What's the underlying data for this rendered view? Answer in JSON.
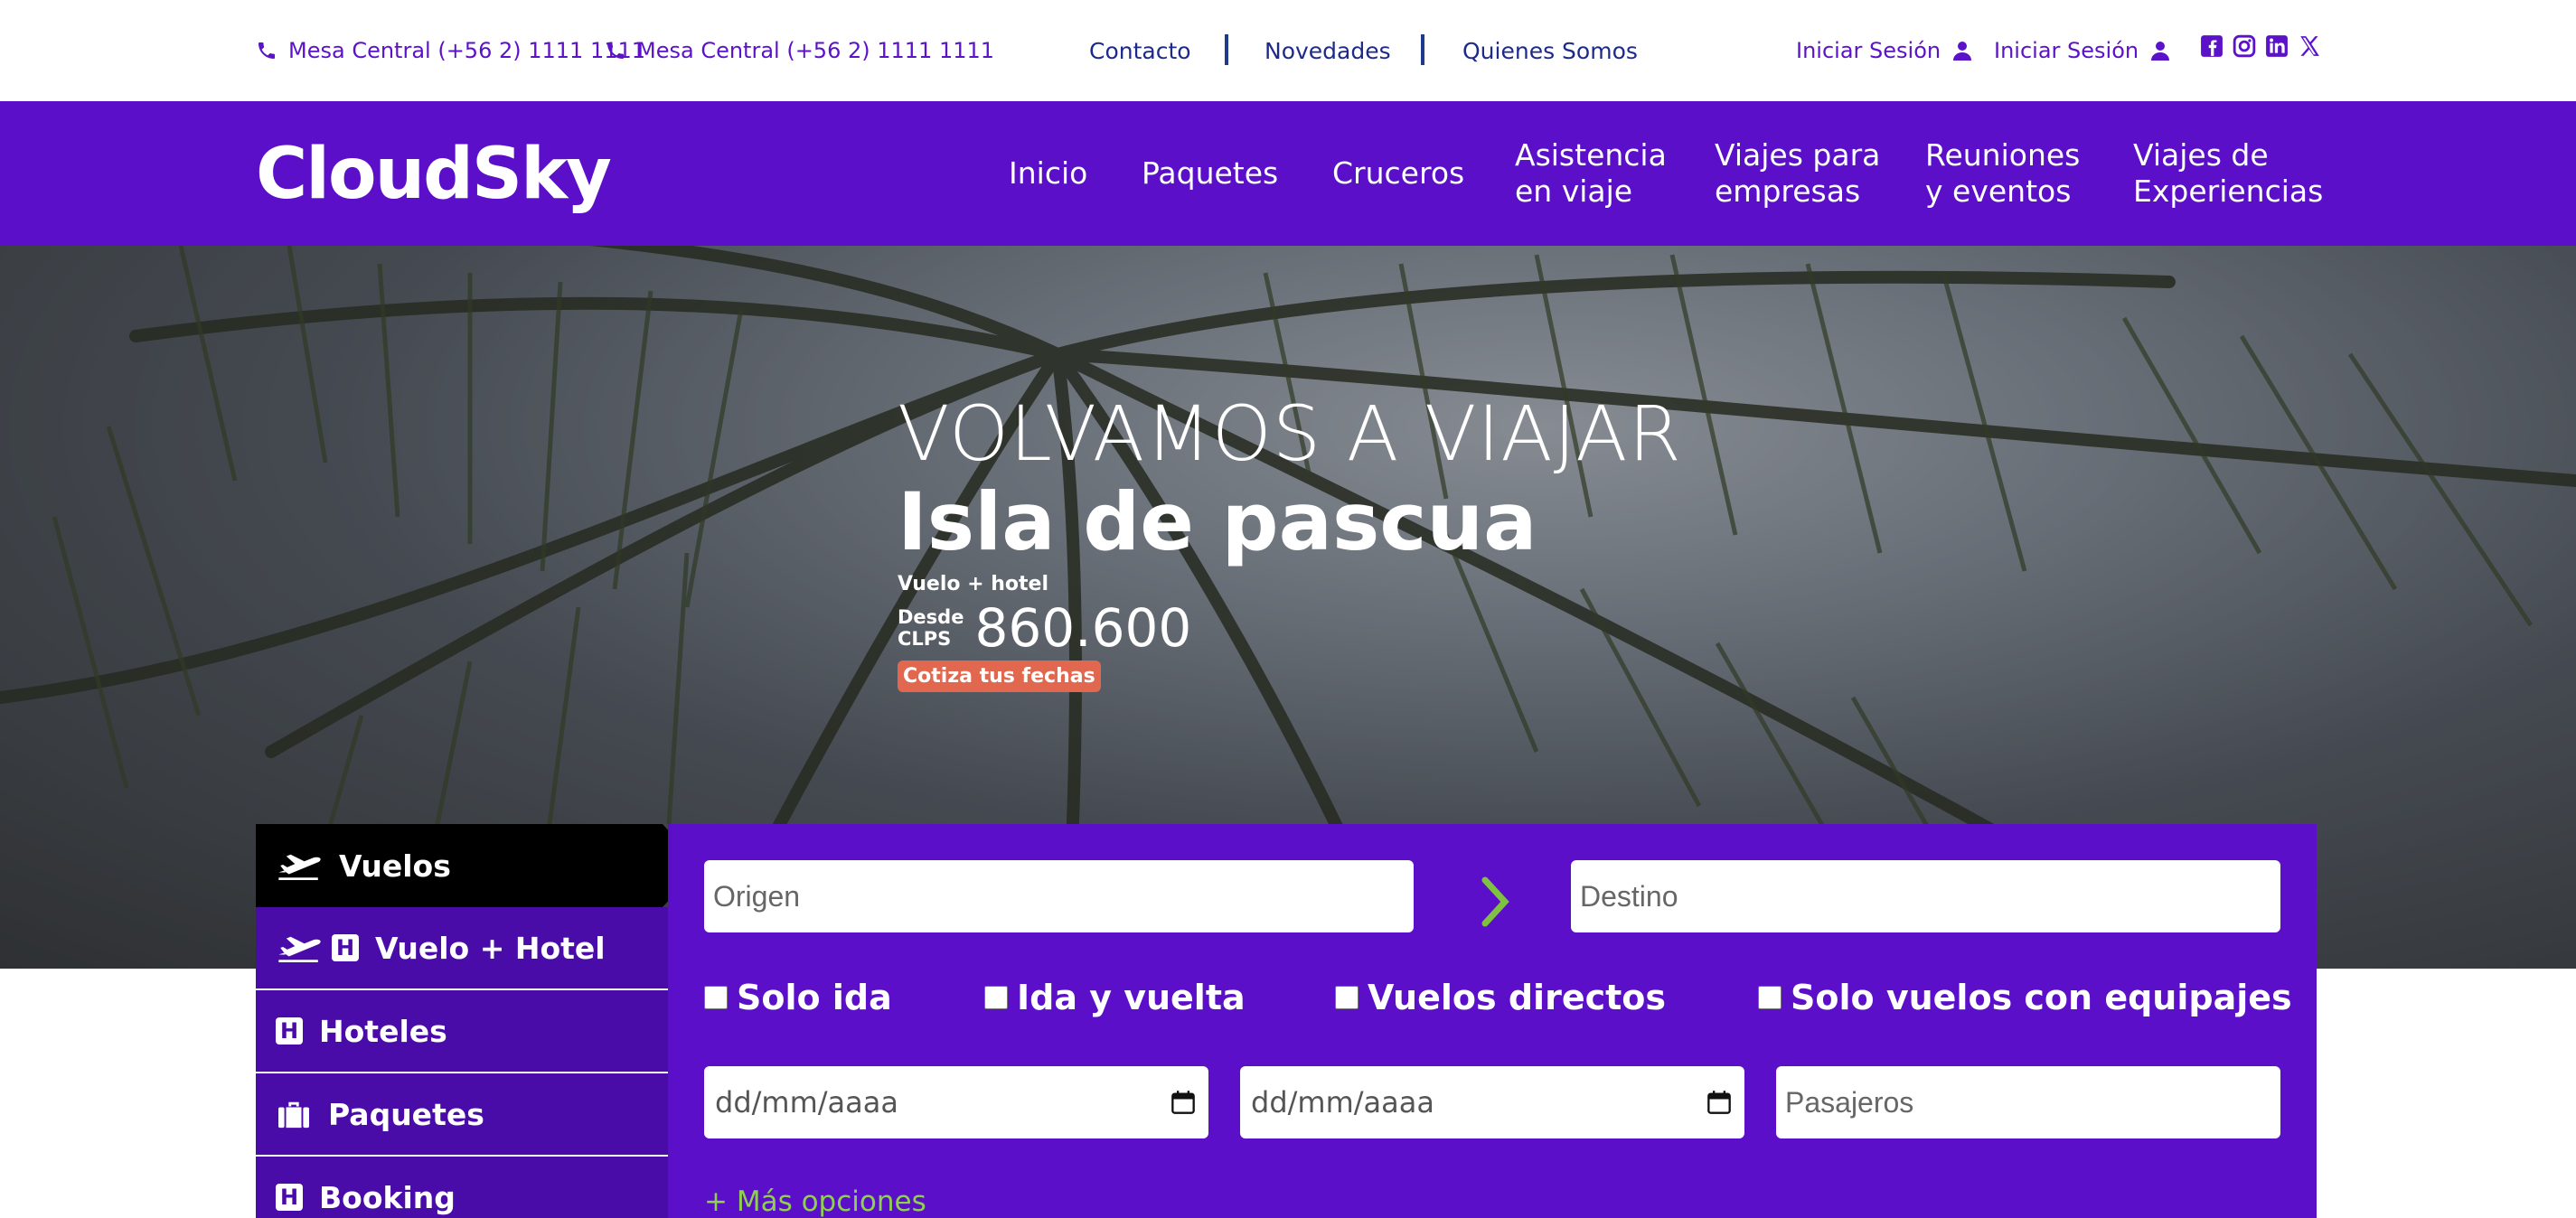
{
  "topbar": {
    "phone_1": "Mesa Central (+56 2) 1111 1111",
    "phone_2": "Mesa Central (+56 2) 1111 1111",
    "links": [
      "Contacto",
      "Novedades",
      "Quienes Somos"
    ],
    "login_1": "Iniciar Sesión",
    "login_2": "Iniciar Sesión",
    "social_icons": [
      "facebook-icon",
      "instagram-icon",
      "linkedin-icon",
      "x-icon"
    ]
  },
  "nav": {
    "logo": "CloudSky",
    "items": [
      {
        "line1": "Inicio",
        "line2": ""
      },
      {
        "line1": "Paquetes",
        "line2": ""
      },
      {
        "line1": "Cruceros",
        "line2": ""
      },
      {
        "line1": "Asistencia",
        "line2": "en viaje"
      },
      {
        "line1": "Viajes para",
        "line2": "empresas"
      },
      {
        "line1": "Reuniones",
        "line2": "y eventos"
      },
      {
        "line1": "Viajes de",
        "line2": "Experiencias"
      }
    ]
  },
  "hero": {
    "tagline": "VOLVAMOS A VIAJAR",
    "destination": "Isla de pascua",
    "subtitle": "Vuelo + hotel",
    "price_label_1": "Desde",
    "price_label_2": "CLPS",
    "price": "860.600",
    "cta": "Cotiza tus fechas"
  },
  "search": {
    "tabs": [
      "Vuelos",
      "Vuelo + Hotel",
      "Hoteles",
      "Paquetes",
      "Booking"
    ],
    "origin_placeholder": "Origen",
    "destination_placeholder": "Destino",
    "checkboxes": [
      "Solo ida",
      "Ida y vuelta",
      "Vuelos directos",
      "Solo vuelos con equipajes"
    ],
    "date_placeholder_1": "dd/mm/aaaa",
    "date_placeholder_2": "dd/mm/aaaa",
    "passengers_placeholder": "Pasajeros",
    "more_options": "+ Más opciones"
  },
  "colors": {
    "brand_purple": "#5b0fc8",
    "dark_purple_tab": "#4a0ca8",
    "active_tab": "#000000",
    "cta_orange": "#e2674f",
    "arrow_green": "#7fc241",
    "link_blue": "#1e2a8a"
  }
}
